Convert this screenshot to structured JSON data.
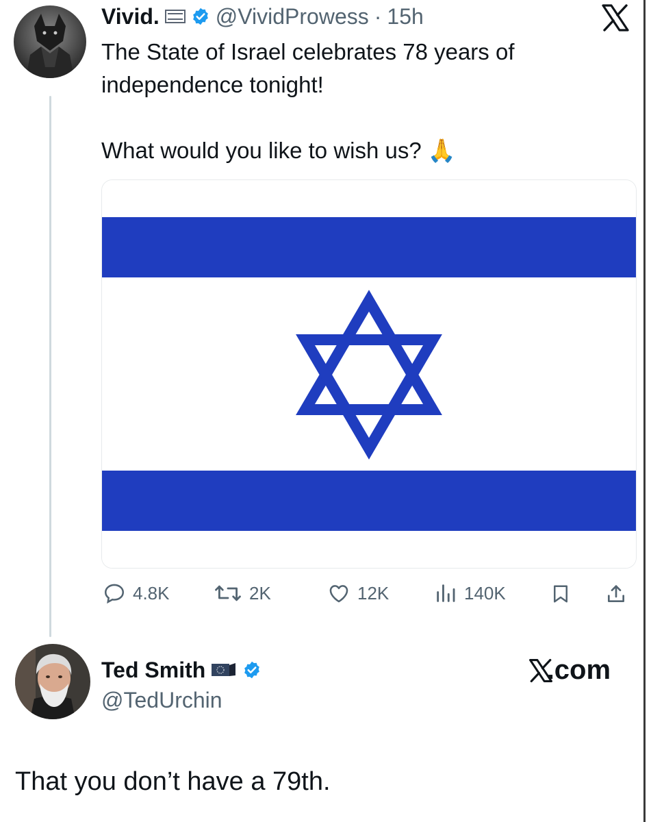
{
  "tweet": {
    "author_name": "Vivid.",
    "author_handle": "@VividProwess",
    "separator": "·",
    "time": "15h",
    "text_line1": "The State of Israel celebrates 78 years of independence tonight!",
    "text_line2": "What would you like to wish us?",
    "emoji": "🙏",
    "verified_color": "#1d9bf0",
    "flag_blue": "#1f3dbf",
    "stats": {
      "replies": "4.8K",
      "reposts": "2K",
      "likes": "12K",
      "views": "140K"
    }
  },
  "reply": {
    "author_name": "Ted Smith",
    "author_handle": "@TedUrchin",
    "text": "That you don’t have a 79th.",
    "site_label": "X.com"
  },
  "icons": [
    "x-logo-icon",
    "verified-badge-icon",
    "flag-icon",
    "reply-icon",
    "repost-icon",
    "like-icon",
    "views-icon",
    "bookmark-icon",
    "share-icon"
  ]
}
